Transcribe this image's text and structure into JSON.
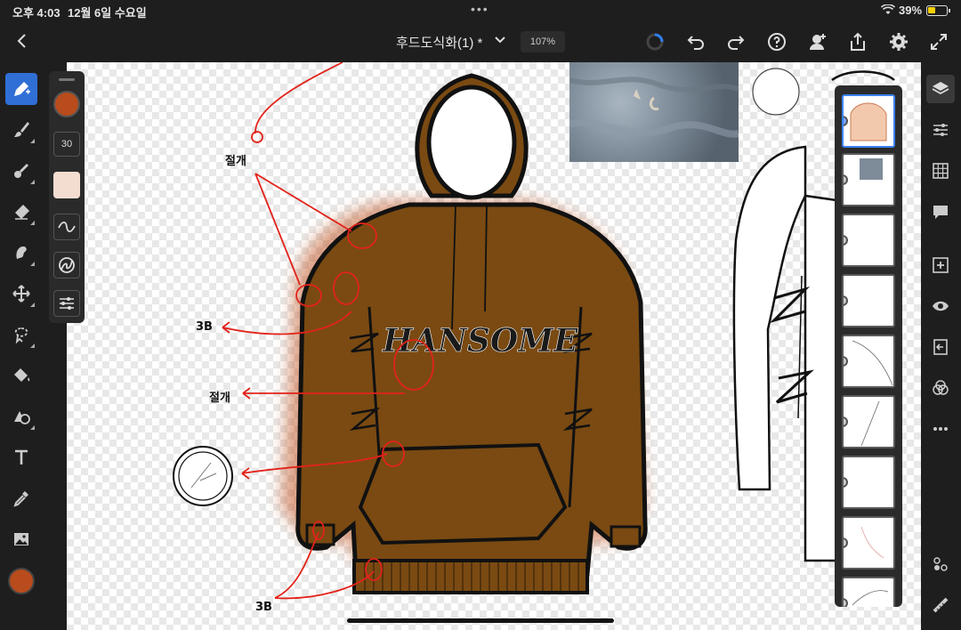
{
  "status": {
    "time": "오후 4:03",
    "date": "12월 6일 수요일",
    "battery": "39%"
  },
  "topbar": {
    "title": "후드도식화(1) *",
    "zoom": "107%"
  },
  "brush": {
    "size": "30",
    "color": "#b84c1c"
  },
  "annotations": {
    "a1": "절개",
    "a2": "3B",
    "a3": "절개",
    "a4": "3B",
    "logo": "HANSOME"
  },
  "colors": {
    "accent": "#2f6fd6",
    "hoodie": "#7a4a12",
    "redline": "#e2231a"
  },
  "icons": {
    "left": [
      "brush-tool-icon",
      "paintbrush-icon",
      "blend-icon",
      "eraser-icon",
      "smudge-icon",
      "move-icon",
      "lasso-icon",
      "fill-icon",
      "shape-icon",
      "text-icon",
      "eyedropper-icon",
      "image-icon"
    ],
    "right": [
      "layers-icon",
      "adjust-icon",
      "grid-icon",
      "comment-icon",
      "add-layer-icon",
      "visibility-icon",
      "export-layer-icon",
      "blend-mode-icon",
      "more-icon",
      "brush-settings-icon",
      "ruler-icon"
    ]
  }
}
